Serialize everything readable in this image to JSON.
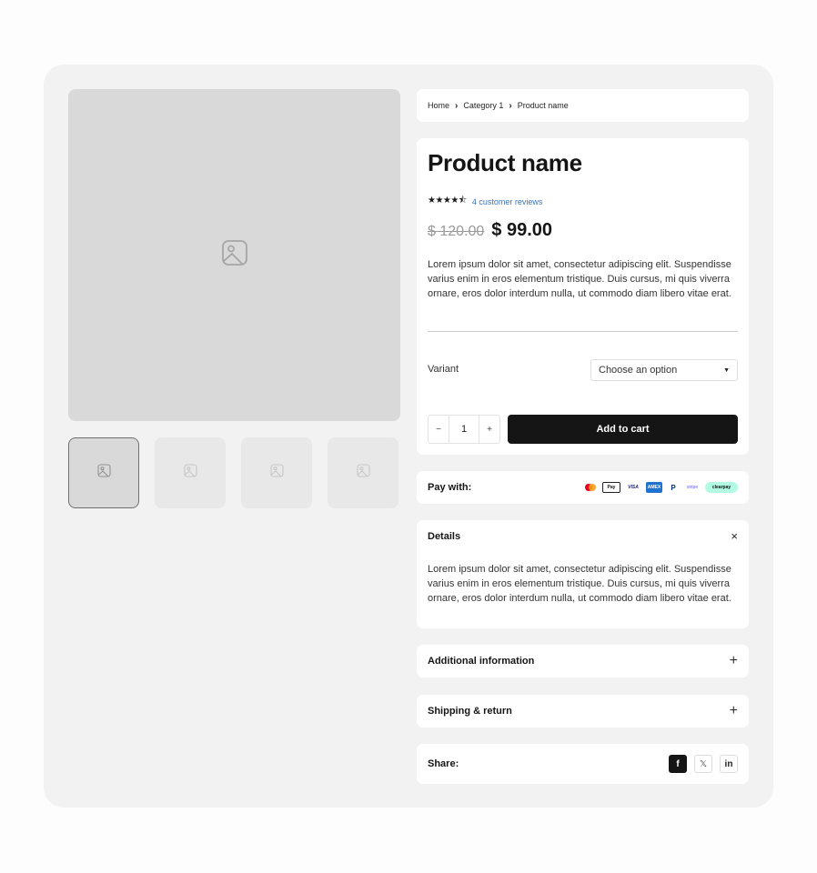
{
  "breadcrumb": {
    "items": [
      "Home",
      "Category 1",
      "Product name"
    ]
  },
  "product": {
    "title": "Product name",
    "stars": "★★★★⯪",
    "rating_value": 4.5,
    "reviews_link": "4 customer reviews",
    "old_price": "$ 120.00",
    "price": "$ 99.00",
    "description": "Lorem ipsum dolor sit amet, consectetur adipiscing elit. Suspendisse varius enim in eros elementum tristique. Duis cursus, mi quis viverra ornare, eros dolor interdum nulla, ut commodo diam libero vitae erat."
  },
  "variant": {
    "label": "Variant",
    "selected": "Choose an option"
  },
  "quantity": {
    "minus": "−",
    "value": "1",
    "plus": "+"
  },
  "cart": {
    "add_label": "Add to cart"
  },
  "payment": {
    "label": "Pay with:",
    "methods": [
      "mastercard-icon",
      "apple-pay-icon",
      "visa-icon",
      "amex-icon",
      "paypal-icon",
      "stripe-icon",
      "clearpay-icon"
    ],
    "applepay_text": "Pay",
    "visa_text": "VISA",
    "amex_text": "AMEX",
    "paypal_text": "P",
    "stripe_text": "stripe",
    "clearpay_text": "clearpay"
  },
  "details": {
    "title": "Details",
    "close": "×",
    "text": "Lorem ipsum dolor sit amet, consectetur adipiscing elit. Suspendisse varius enim in eros elementum tristique. Duis cursus, mi quis viverra ornare, eros dolor interdum nulla, ut commodo diam libero vitae erat."
  },
  "accordions": {
    "additional": "Additional information",
    "shipping": "Shipping & return",
    "toggle": "+"
  },
  "share": {
    "label": "Share:",
    "facebook": "f",
    "x": "𝕏",
    "linkedin": "in"
  },
  "gallery": {
    "thumb_count": 4,
    "active_thumb": 1
  },
  "colors": {
    "frame_bg": "#f2f2f2",
    "image_placeholder": "#d9d9d9",
    "primary_button": "#151515",
    "link": "#3a74b8"
  }
}
